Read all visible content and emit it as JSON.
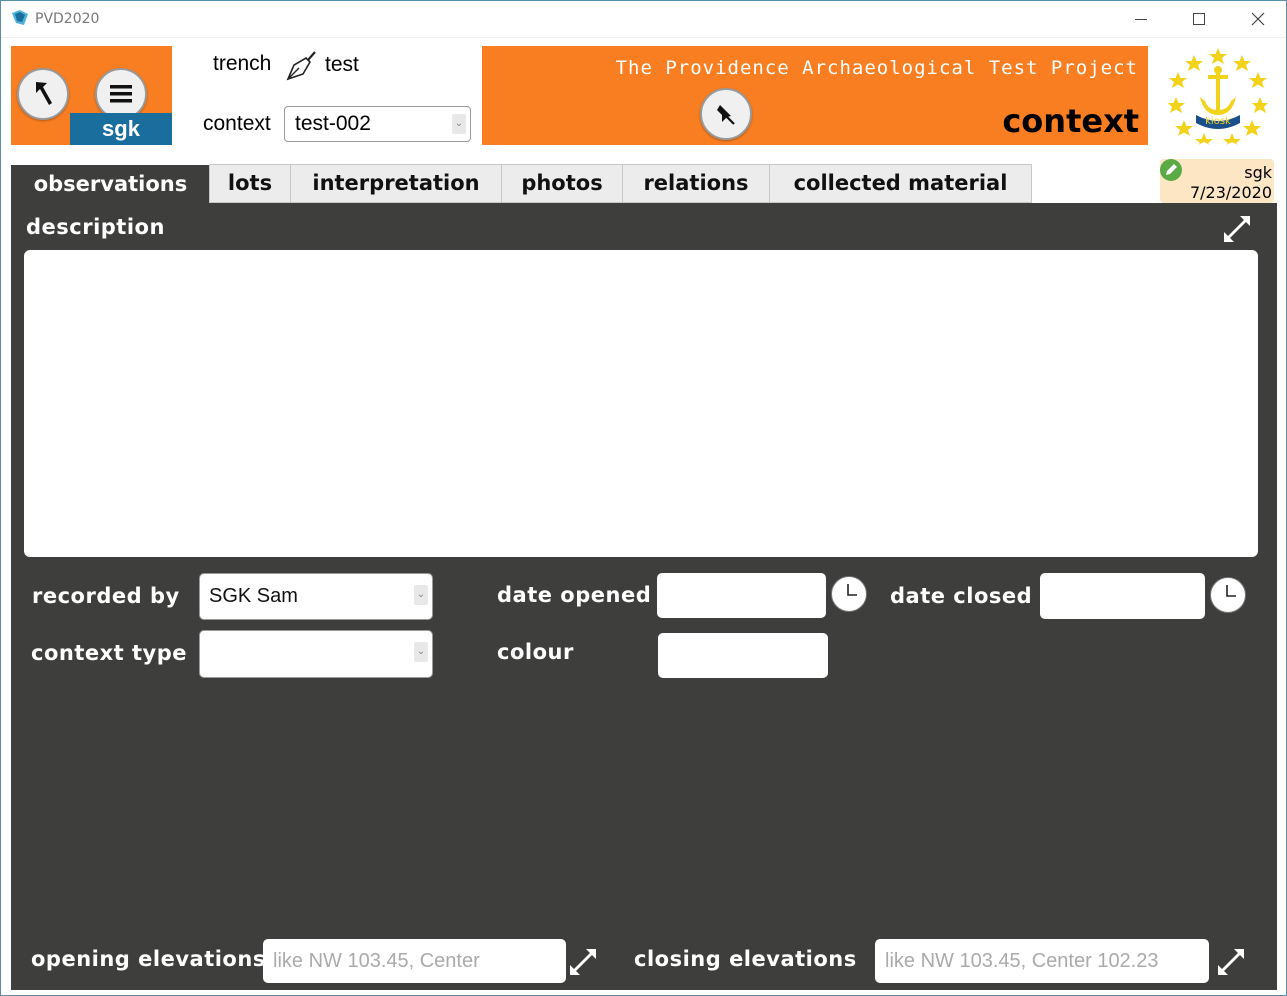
{
  "window": {
    "title": "PVD2020",
    "minimize_label": "",
    "maximize_label": "",
    "close_label": ""
  },
  "header": {
    "user": "sgk",
    "trench_label": "trench",
    "trench_value": "test",
    "context_label": "context",
    "context_value": "test-002",
    "project_title": "The Providence Archaeological Test Project",
    "page_heading": "context",
    "seal_text": "kiosk"
  },
  "tabs": [
    {
      "label": "observations",
      "active": true
    },
    {
      "label": "lots",
      "active": false
    },
    {
      "label": "interpretation",
      "active": false
    },
    {
      "label": "photos",
      "active": false
    },
    {
      "label": "relations",
      "active": false
    },
    {
      "label": "collected material",
      "active": false
    }
  ],
  "edit_info": {
    "user": "sgk",
    "date": "7/23/2020"
  },
  "form": {
    "description_label": "description",
    "description_value": "",
    "recorded_by_label": "recorded by",
    "recorded_by_value": "SGK Sam",
    "date_opened_label": "date opened",
    "date_opened_value": "",
    "date_closed_label": "date closed",
    "date_closed_value": "",
    "context_type_label": "context type",
    "context_type_value": "",
    "colour_label": "colour",
    "colour_value": "",
    "opening_elevations_label": "opening elevations",
    "opening_elevations_placeholder": "like NW 103.45, Center",
    "closing_elevations_label": "closing elevations",
    "closing_elevations_placeholder": "like NW 103.45, Center 102.23"
  },
  "colors": {
    "accent_orange": "#f97e22",
    "user_badge_blue": "#1a6e9e",
    "panel_dark": "#3e3e3c",
    "edit_info_bg": "#fde6c4"
  }
}
